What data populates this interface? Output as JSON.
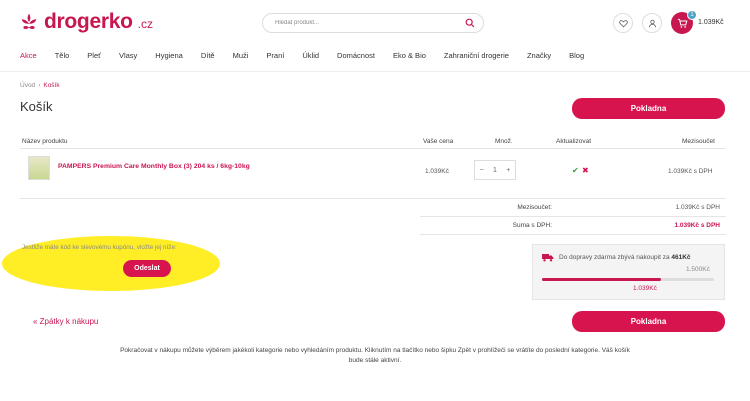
{
  "header": {
    "logo_text": "drogerko",
    "logo_suffix": ".cz",
    "search_placeholder": "Hledat produkt...",
    "cart_count": "1",
    "cart_total": "1.039Kč"
  },
  "nav": [
    "Akce",
    "Tělo",
    "Pleť",
    "Vlasy",
    "Hygiena",
    "Dítě",
    "Muži",
    "Praní",
    "Úklid",
    "Domácnost",
    "Eko & Bio",
    "Zahraniční drogerie",
    "Značky",
    "Blog"
  ],
  "breadcrumb": {
    "home": "Úvod",
    "separator": "›",
    "current": "Košík"
  },
  "page_title": "Košík",
  "checkout_label": "Pokladna",
  "table": {
    "headers": {
      "name": "Název produktu",
      "price": "Vaše cena",
      "qty": "Množ.",
      "update": "Aktualizovat",
      "subtotal": "Mezisoučet"
    },
    "rows": [
      {
        "name": "PAMPERS Premium Care Monthly Box (3) 204 ks / 6kg-10kg",
        "price": "1.039Kč",
        "qty_minus": "−",
        "qty": "1",
        "qty_plus": "+",
        "update_ok": "✔",
        "update_remove": "✖",
        "total": "1.039Kč s DPH"
      }
    ]
  },
  "summary": {
    "subtotal_label": "Mezisoučet:",
    "subtotal_value": "1.039Kč s DPH",
    "total_label": "Suma s DPH:",
    "total_value": "1.039Kč s DPH"
  },
  "coupon": {
    "text": "Jestliže máte kód ke slevovému kupónu, vložte jej níže:",
    "button": "Odeslat"
  },
  "shipping": {
    "text_prefix": "Do dopravy zdarma zbývá nakoupit za",
    "remaining": "461Kč",
    "threshold": "1.500Kč",
    "current": "1.039Kč",
    "progress": 0.69
  },
  "back_link": "« Zpátky k nákupu",
  "footer_note": "Pokračovat v nákupu můžete výběrem jakékoli kategorie nebo vyhledáním produktu. Kliknutím na tlačítko nebo šipku Zpět v prohlížeči se vrátíte do poslední kategorie. Váš košík bude stále aktivní.",
  "colors": {
    "accent": "#d8144f",
    "badge": "#4fa3c7",
    "highlight": "#ffeb00"
  }
}
